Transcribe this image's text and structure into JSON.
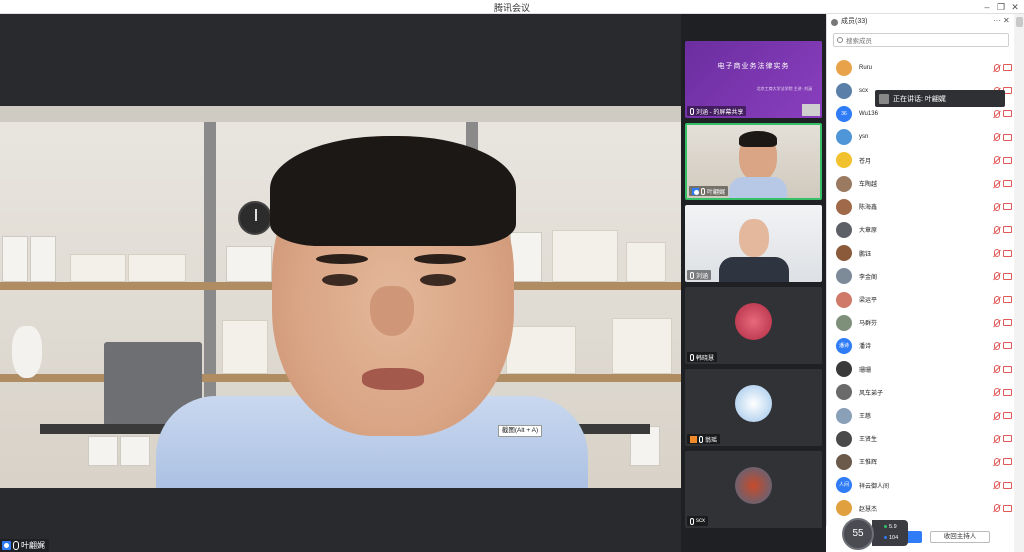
{
  "window": {
    "title": "腾讯会议"
  },
  "main": {
    "speaker_name": "叶翩娓",
    "tooltip": "截图(Alt + A)"
  },
  "gallery": {
    "tiles": [
      {
        "label": "刘涵 - 的屏幕共享",
        "slide_title": "电子商业务法律实务",
        "slide_sub": "北京工商大学法学院\n主讲: 刘涵"
      },
      {
        "label": "叶翩娓"
      },
      {
        "label": "刘涵"
      },
      {
        "label": "韩晓慧"
      },
      {
        "label": "翁瑶"
      },
      {
        "label": "scx"
      }
    ]
  },
  "panel": {
    "title": "成员(33)",
    "search_placeholder": "搜索成员",
    "speaking_now": "正在讲话: 叶翩娓",
    "reclaim_host": "收回主持人",
    "members": [
      {
        "name": "Ruru",
        "avatar_color": "#e8a34a",
        "avatar_text": ""
      },
      {
        "name": "scx",
        "avatar_color": "#5a7fa8",
        "avatar_text": ""
      },
      {
        "name": "Wu136",
        "avatar_color": "#2f7cf6",
        "avatar_text": "36"
      },
      {
        "name": "ysn",
        "avatar_color": "#4f96d8",
        "avatar_text": ""
      },
      {
        "name": "苍月",
        "avatar_color": "#f2c12e",
        "avatar_text": ""
      },
      {
        "name": "车陶越",
        "avatar_color": "#9b7a62",
        "avatar_text": ""
      },
      {
        "name": "陈海鑫",
        "avatar_color": "#a06a4a",
        "avatar_text": ""
      },
      {
        "name": "大章原",
        "avatar_color": "#5d6066",
        "avatar_text": ""
      },
      {
        "name": "鹏钰",
        "avatar_color": "#8a5a3a",
        "avatar_text": ""
      },
      {
        "name": "李金阁",
        "avatar_color": "#7d8a98",
        "avatar_text": ""
      },
      {
        "name": "梁运平",
        "avatar_color": "#d07a6a",
        "avatar_text": ""
      },
      {
        "name": "马群芬",
        "avatar_color": "#7e8f7a",
        "avatar_text": ""
      },
      {
        "name": "潘诗",
        "avatar_color": "#2f7cf6",
        "avatar_text": "潘诗"
      },
      {
        "name": "珊珊",
        "avatar_color": "#3a3a3a",
        "avatar_text": ""
      },
      {
        "name": "风车弟子",
        "avatar_color": "#6a6a6a",
        "avatar_text": ""
      },
      {
        "name": "王慈",
        "avatar_color": "#8aa0b8",
        "avatar_text": ""
      },
      {
        "name": "王贤生",
        "avatar_color": "#4a4a4a",
        "avatar_text": ""
      },
      {
        "name": "王惟辉",
        "avatar_color": "#6b5a4a",
        "avatar_text": ""
      },
      {
        "name": "祥云御人间",
        "avatar_color": "#2f7cf6",
        "avatar_text": "人间"
      },
      {
        "name": "赵慧杰",
        "avatar_color": "#e0a040",
        "avatar_text": ""
      }
    ]
  },
  "network": {
    "quality": "55",
    "upload": "5.9",
    "download": "104"
  },
  "colors": {
    "accent": "#2f7cf6",
    "active_border": "#35c067",
    "muted": "#e05a5a"
  }
}
